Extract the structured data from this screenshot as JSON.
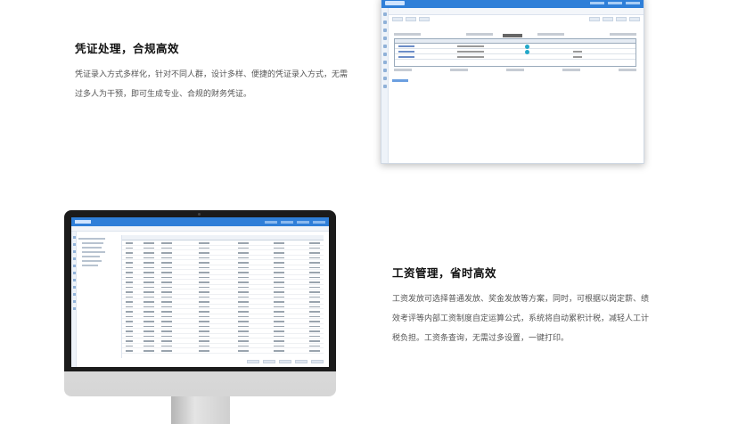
{
  "voucher_section": {
    "title": "凭证处理，合规高效",
    "description": "凭证录入方式多样化，针对不同人群，设计多样、便捷的凭证录入方式，无需过多人为干预，即可生成专业、合规的财务凭证。"
  },
  "payroll_section": {
    "title": "工资管理，省时高效",
    "description": "工资发放可选择普通发放、奖金发放等方案，同时，可根据以岗定薪、绩效考评等内部工资制度自定运算公式，系统将自动累积计税，减轻人工计税负担。工资条查询，无需过多设置，一键打印。"
  },
  "colors": {
    "brand_blue": "#2f7fd8",
    "heading": "#111111",
    "body_text": "#555555"
  }
}
